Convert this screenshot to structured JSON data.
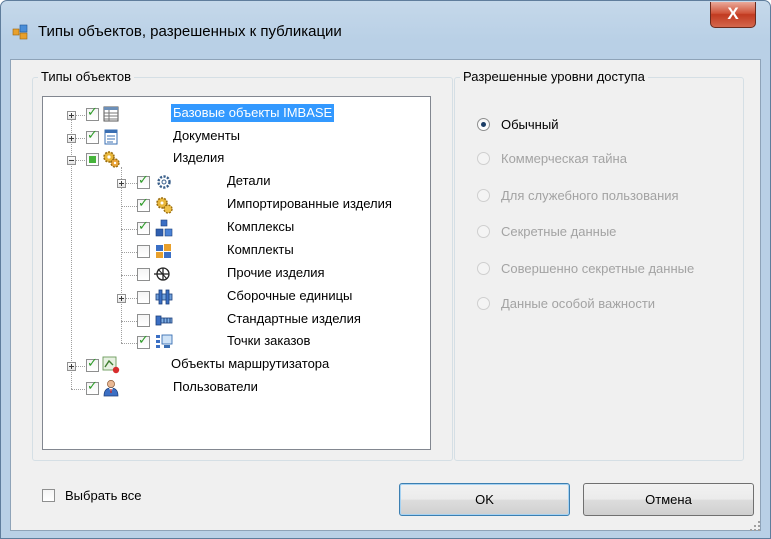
{
  "window": {
    "title": "Типы объектов, разрешенных к публикации",
    "close_glyph": "X",
    "icon": "window-app-icon"
  },
  "object_types_group": {
    "caption": "Типы объектов",
    "tree": [
      {
        "label": "Базовые объекты IMBASE",
        "checked": true,
        "expandable": true,
        "selected": true,
        "icon": "table-icon"
      },
      {
        "label": "Документы",
        "checked": true,
        "expandable": true,
        "icon": "document-icon"
      },
      {
        "label": "Изделия",
        "checked": "partial",
        "expanded": true,
        "icon": "gears-icon"
      },
      {
        "label": "Детали",
        "checked": true,
        "expandable": true,
        "icon": "gear-icon"
      },
      {
        "label": "Импортированные изделия",
        "checked": true,
        "icon": "imported-gears-icon"
      },
      {
        "label": "Комплексы",
        "checked": true,
        "icon": "complex-icon"
      },
      {
        "label": "Комплекты",
        "checked": false,
        "icon": "kit-icon"
      },
      {
        "label": "Прочие изделия",
        "checked": false,
        "icon": "other-items-icon"
      },
      {
        "label": "Сборочные единицы",
        "checked": false,
        "expandable": true,
        "icon": "assembly-icon"
      },
      {
        "label": "Стандартные изделия",
        "checked": false,
        "icon": "standard-item-icon"
      },
      {
        "label": "Точки заказов",
        "checked": true,
        "icon": "order-point-icon"
      },
      {
        "label": "Объекты маршрутизатора",
        "checked": true,
        "expandable": true,
        "icon": "router-object-icon"
      },
      {
        "label": "Пользователи",
        "checked": true,
        "icon": "user-icon"
      }
    ]
  },
  "access_levels_group": {
    "caption": "Разрешенные уровни доступа",
    "options": [
      {
        "label": "Обычный",
        "selected": true,
        "enabled": true
      },
      {
        "label": "Коммерческая тайна",
        "selected": false,
        "enabled": false
      },
      {
        "label": "Для служебного пользования",
        "selected": false,
        "enabled": false
      },
      {
        "label": "Секретные данные",
        "selected": false,
        "enabled": false
      },
      {
        "label": "Совершенно секретные данные",
        "selected": false,
        "enabled": false
      },
      {
        "label": "Данные особой важности",
        "selected": false,
        "enabled": false
      }
    ]
  },
  "footer": {
    "select_all_label": "Выбрать все",
    "select_all_checked": false,
    "ok_label": "OK",
    "cancel_label": "Отмена"
  },
  "colors": {
    "selection": "#3399ff",
    "check": "#2d9b28",
    "titlebar": "#b9d0e6",
    "close_button": "#c13a20"
  }
}
